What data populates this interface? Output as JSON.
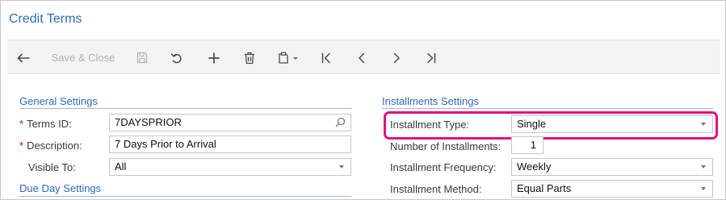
{
  "page": {
    "title": "Credit Terms"
  },
  "toolbar": {
    "save_close_label": "Save & Close"
  },
  "general": {
    "section_title": "General Settings",
    "terms_id": {
      "label": "Terms ID:",
      "value": "7DAYSPRIOR"
    },
    "description": {
      "label": "Description:",
      "value": "7 Days Prior to Arrival"
    },
    "visible_to": {
      "label": "Visible To:",
      "value": "All"
    },
    "required_mark": "*"
  },
  "due_day": {
    "section_title": "Due Day Settings"
  },
  "installments": {
    "section_title": "Installments Settings",
    "type": {
      "label": "Installment Type:",
      "value": "Single"
    },
    "number": {
      "label": "Number of Installments:",
      "value": "1"
    },
    "frequency": {
      "label": "Installment Frequency:",
      "value": "Weekly"
    },
    "method": {
      "label": "Installment Method:",
      "value": "Equal Parts"
    }
  },
  "colors": {
    "accent": "#2d6ab8",
    "highlight": "#e0127a",
    "required": "#d0021b"
  },
  "icons": [
    "back-arrow-icon",
    "save-icon",
    "undo-icon",
    "add-icon",
    "delete-icon",
    "copy-paste-icon",
    "first-record-icon",
    "previous-record-icon",
    "next-record-icon",
    "last-record-icon",
    "search-icon",
    "chevron-down-icon"
  ]
}
